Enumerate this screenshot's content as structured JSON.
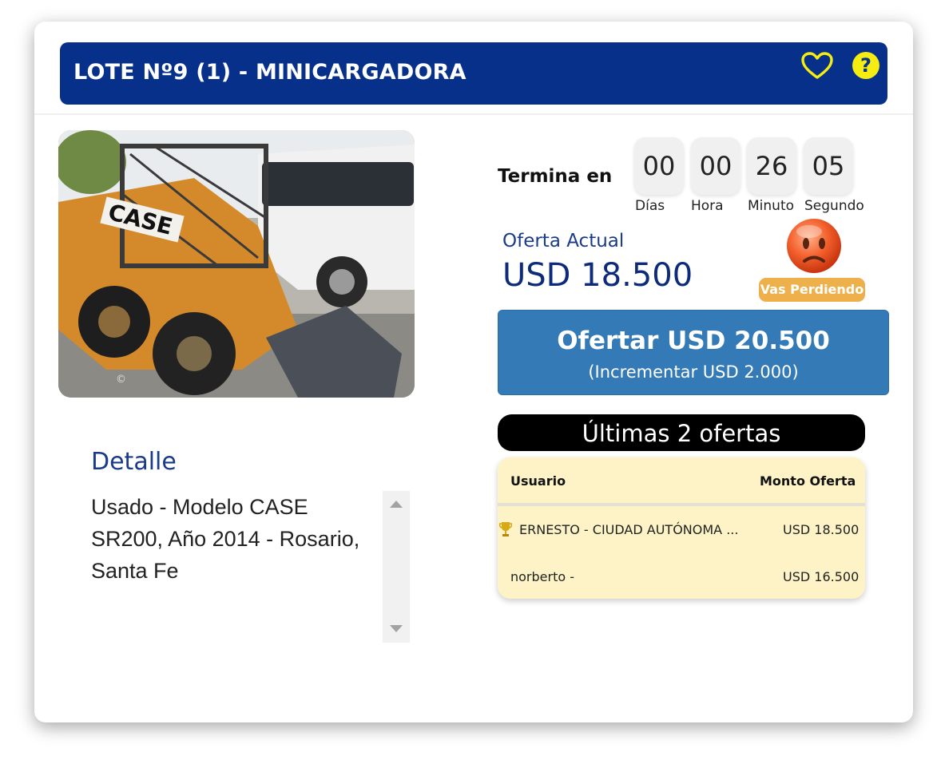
{
  "header": {
    "title": "LOTE Nº9 (1) - MINICARGADORA",
    "favorite_icon": "heart-outline-icon",
    "help_icon": "question-circle-icon",
    "help_glyph": "?"
  },
  "photo": {
    "description_icon": "product-photo",
    "copyright": "©"
  },
  "detalle": {
    "title": "Detalle",
    "text": "Usado - Modelo CASE SR200, Año 2014 - Rosario, Santa Fe"
  },
  "countdown": {
    "label": "Termina en",
    "units": [
      {
        "value": "00",
        "label": "Días"
      },
      {
        "value": "00",
        "label": "Hora"
      },
      {
        "value": "26",
        "label": "Minuto"
      },
      {
        "value": "05",
        "label": "Segundo"
      }
    ]
  },
  "offer": {
    "label": "Oferta Actual",
    "value": "USD 18.500",
    "status_icon": "sad-face-icon",
    "status": "Vas Perdiendo"
  },
  "bid_button": {
    "main": "Ofertar USD 20.500",
    "sub": "(Incrementar USD 2.000)"
  },
  "last_offers": {
    "title": "Últimas 2 ofertas",
    "columns": [
      "Usuario",
      "Monto Oferta"
    ],
    "rows": [
      {
        "user": "ERNESTO - CIUDAD AUTÓNOMA ...",
        "amount": "USD 18.500",
        "icon": "trophy-icon"
      },
      {
        "user": "norberto -",
        "amount": "USD 16.500"
      }
    ]
  },
  "colors": {
    "header_bg": "#07308a",
    "accent_yellow": "#f5ec12",
    "button_blue": "#337ab7",
    "status_orange": "#eeb04a",
    "table_bg": "#fdf3c6"
  }
}
